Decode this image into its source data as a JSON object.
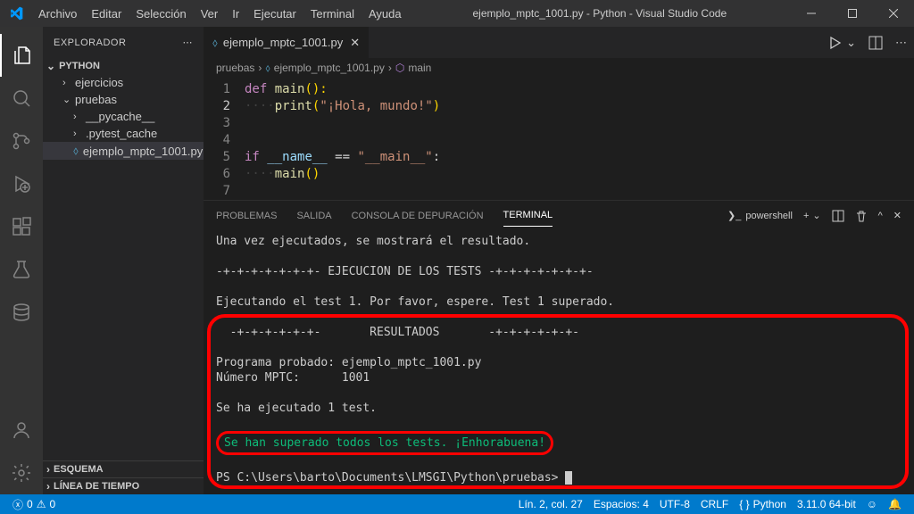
{
  "titlebar": {
    "menus": [
      "Archivo",
      "Editar",
      "Selección",
      "Ver",
      "Ir",
      "Ejecutar",
      "Terminal",
      "Ayuda"
    ],
    "title": "ejemplo_mptc_1001.py - Python - Visual Studio Code"
  },
  "sidebar": {
    "title": "EXPLORADOR",
    "root": "PYTHON",
    "items": [
      {
        "label": "ejercicios",
        "type": "folder",
        "open": false,
        "nested": 1
      },
      {
        "label": "pruebas",
        "type": "folder",
        "open": true,
        "nested": 1
      },
      {
        "label": "__pycache__",
        "type": "folder",
        "open": false,
        "nested": 2
      },
      {
        "label": ".pytest_cache",
        "type": "folder",
        "open": false,
        "nested": 2
      },
      {
        "label": "ejemplo_mptc_1001.py",
        "type": "file",
        "nested": 2,
        "selected": true
      }
    ],
    "bottom1": "ESQUEMA",
    "bottom2": "LÍNEA DE TIEMPO"
  },
  "breadcrumb": {
    "p1": "pruebas",
    "p2": "ejemplo_mptc_1001.py",
    "p3": "main"
  },
  "tab": {
    "name": "ejemplo_mptc_1001.py"
  },
  "code": {
    "lines": 7,
    "l1_kw": "def",
    "l1_fn": "main",
    "l1_par": "():",
    "l2_fn": "print",
    "l2_str": "\"¡Hola, mundo!\"",
    "l5_kw": "if",
    "l5_var": "__name__",
    "l5_op": " == ",
    "l5_str": "\"__main__\"",
    "l5_end": ":",
    "l6_fn": "main",
    "l6_par": "()"
  },
  "panel": {
    "tabs": [
      "PROBLEMAS",
      "SALIDA",
      "CONSOLA DE DEPURACIÓN",
      "TERMINAL"
    ],
    "shell": "powershell"
  },
  "terminal": {
    "l1": "Una vez ejecutados, se mostrará el resultado.",
    "l2": "-+-+-+-+-+-+-+- EJECUCION DE LOS TESTS -+-+-+-+-+-+-+-",
    "l3": "Ejecutando el test 1. Por favor, espere. Test 1 superado.",
    "l4": "  -+-+-+-+-+-+-       RESULTADOS       -+-+-+-+-+-+-",
    "l5": "Programa probado: ejemplo_mptc_1001.py",
    "l6": "Número MPTC:      1001",
    "l7": "Se ha ejecutado 1 test.",
    "l8": "Se han superado todos los tests. ¡Enhorabuena!",
    "prompt": "PS C:\\Users\\barto\\Documents\\LMSGI\\Python\\pruebas> "
  },
  "statusbar": {
    "errors": "0",
    "warnings": "0",
    "lncol": "Lín. 2, col. 27",
    "spaces": "Espacios: 4",
    "encoding": "UTF-8",
    "eol": "CRLF",
    "lang": "Python",
    "interp": "3.11.0 64-bit"
  }
}
